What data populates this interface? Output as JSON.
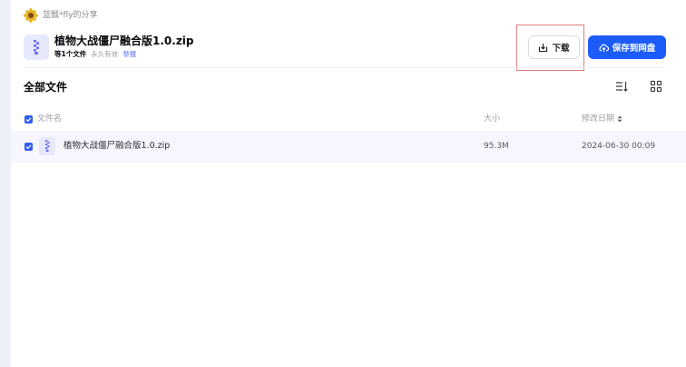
{
  "sharer": {
    "name": "蓝瓢*fly的分享",
    "avatar_icon": "sunflower-avatar-icon"
  },
  "share": {
    "title": "植物大战僵尸融合版1.0.zip",
    "file_count": "等1个文件",
    "validity": "永久有效",
    "report_label": "举报",
    "file_icon": "zip-file-icon"
  },
  "actions": {
    "download_label": "下载",
    "save_label": "保存到网盘",
    "accent_color": "#1b5cf9"
  },
  "section": {
    "title": "全部文件",
    "sort_icon": "sort-list-icon",
    "view_icon": "grid-view-icon"
  },
  "table": {
    "headers": {
      "name": "文件名",
      "size": "大小",
      "date": "修改日期"
    },
    "rows": [
      {
        "name": "植物大战僵尸融合版1.0.zip",
        "size": "95.3M",
        "date": "2024-06-30 00:09",
        "selected": true
      }
    ]
  }
}
